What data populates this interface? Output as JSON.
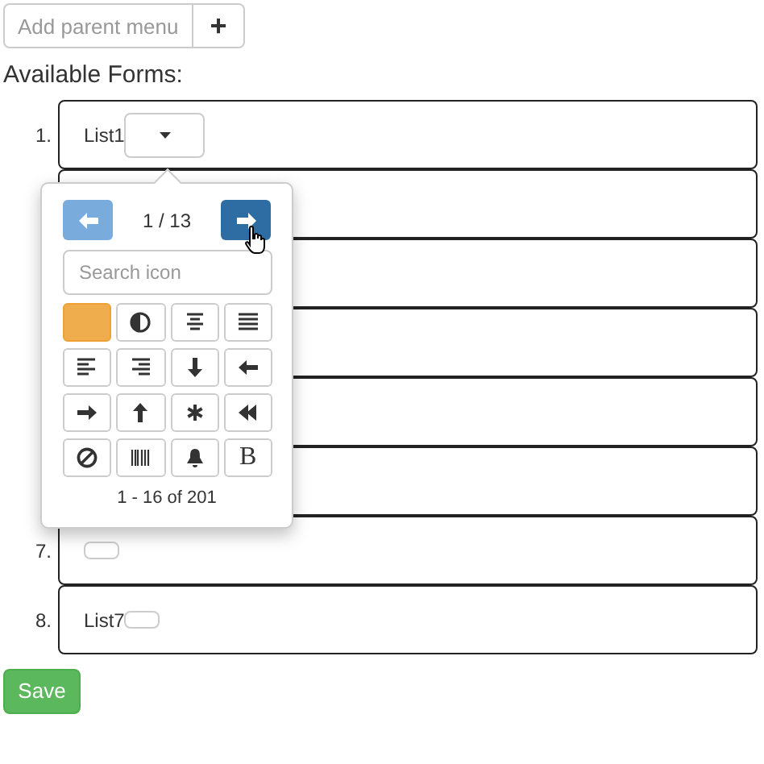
{
  "parent_menu": {
    "placeholder": "Add parent menu",
    "add_button": "+"
  },
  "heading": "Available Forms:",
  "forms": [
    {
      "kind": "dropdown",
      "number": "1.",
      "label": "List1"
    },
    {
      "kind": "plain"
    },
    {
      "kind": "plain"
    },
    {
      "kind": "plain"
    },
    {
      "kind": "plain"
    },
    {
      "kind": "plain"
    },
    {
      "kind": "small-button",
      "number": "7."
    },
    {
      "kind": "small-button",
      "number": "8.",
      "label": "List7"
    }
  ],
  "icon_picker": {
    "page": "1 / 13",
    "search": {
      "placeholder": "Search icon"
    },
    "icons": [
      {
        "kind": "blank",
        "selected": true
      },
      {
        "kind": "adjust",
        "selected": false
      },
      {
        "kind": "align-center",
        "selected": false
      },
      {
        "kind": "justify",
        "selected": false
      },
      {
        "kind": "align-left",
        "selected": false
      },
      {
        "kind": "align-right",
        "selected": false
      },
      {
        "kind": "arrow-down",
        "selected": false
      },
      {
        "kind": "arrow-left",
        "selected": false
      },
      {
        "kind": "arrow-right",
        "selected": false
      },
      {
        "kind": "arrow-up",
        "selected": false
      },
      {
        "kind": "asterisk",
        "selected": false
      },
      {
        "kind": "backward",
        "selected": false
      },
      {
        "kind": "ban",
        "selected": false
      },
      {
        "kind": "barcode",
        "selected": false
      },
      {
        "kind": "bell",
        "selected": false
      },
      {
        "kind": "glyph",
        "glyph": "B",
        "selected": false
      }
    ],
    "footer": "1 - 16 of 201"
  },
  "save_button": "Save"
}
